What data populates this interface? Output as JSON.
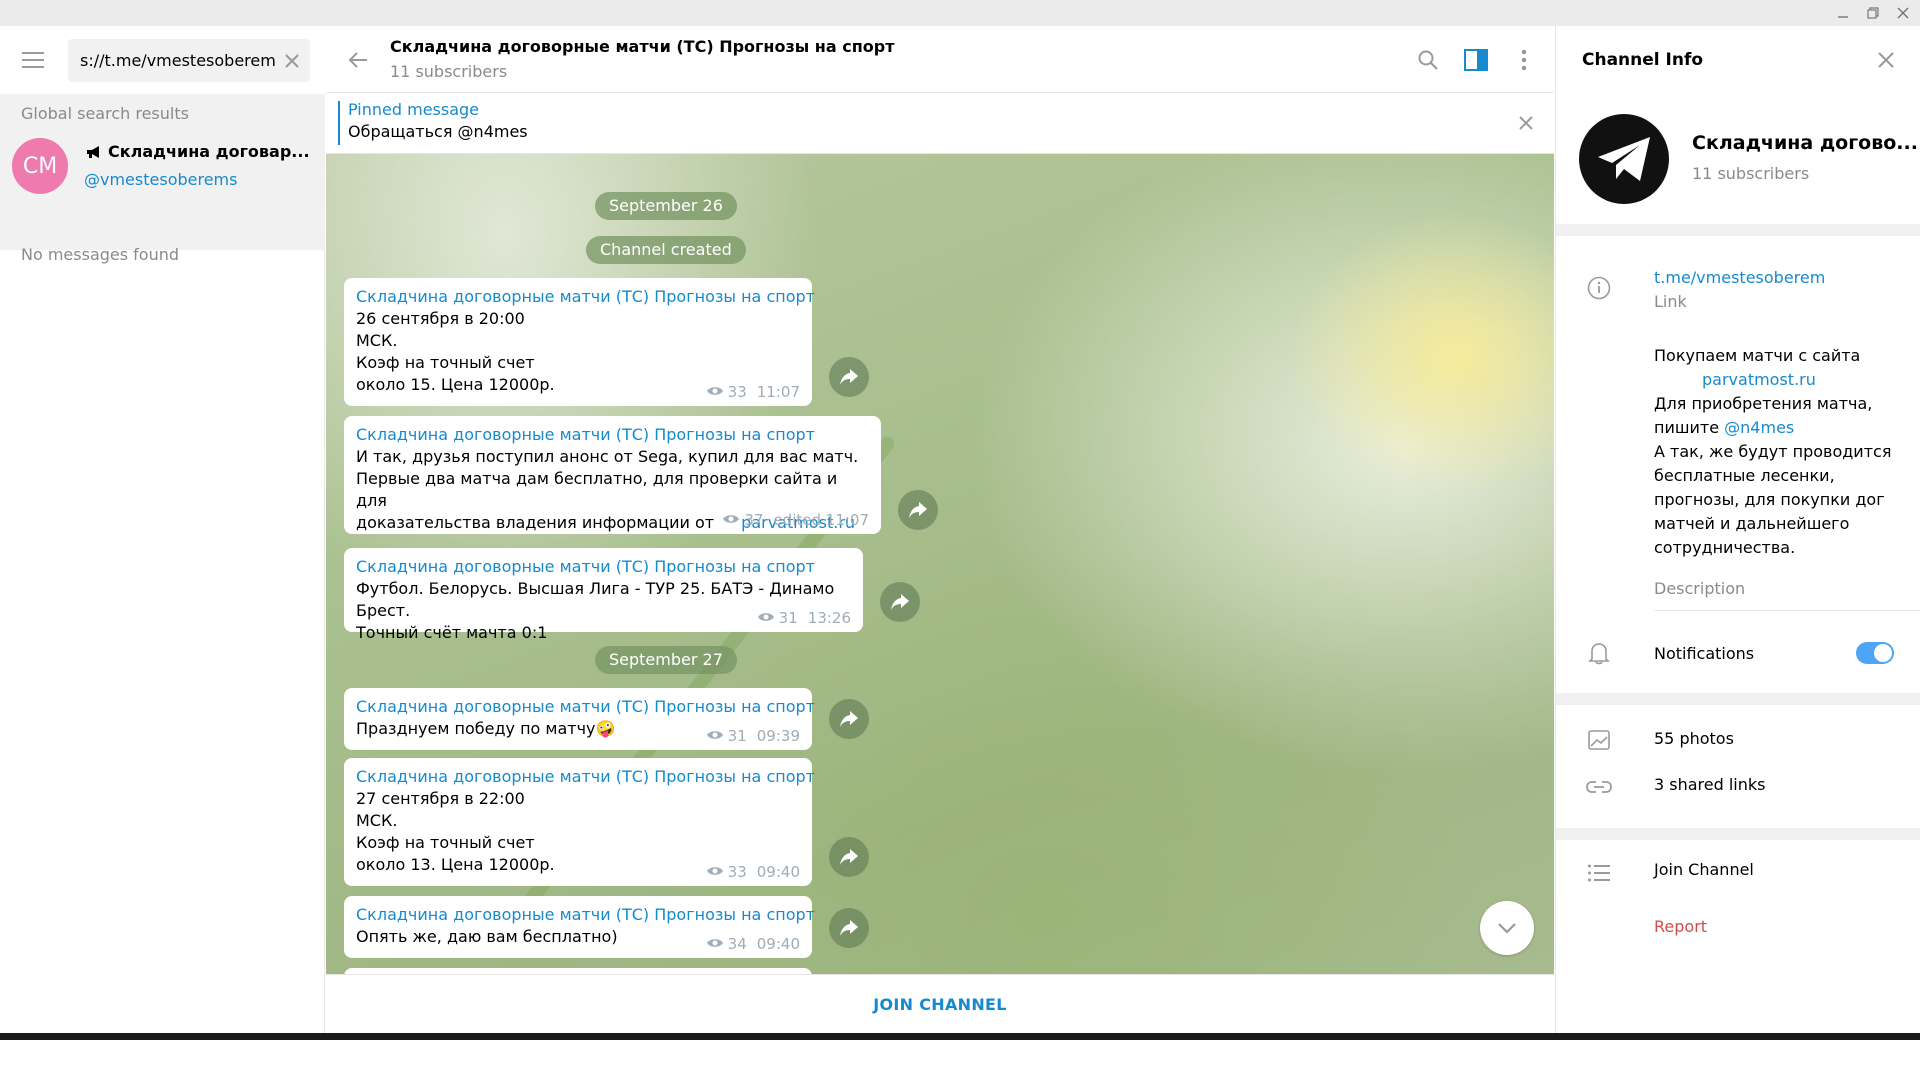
{
  "window": {
    "controls": [
      "minimize",
      "maximize",
      "close"
    ]
  },
  "left": {
    "search_value": "s://t.me/vmestesoberems",
    "results_header": "Global search results",
    "result": {
      "avatar_initials": "CM",
      "avatar_color": "#ee7aae",
      "title": "Складчина договар...",
      "handle": "@vmestesoberems"
    },
    "no_messages": "No messages found"
  },
  "chat": {
    "title": "Складчина договорные матчи (ТС) Прогнозы на спорт",
    "subscribers": "11 subscribers",
    "pinned_label": "Pinned message",
    "pinned_text": "Обращаться @n4mes",
    "date1": "September 26",
    "service": "Channel created",
    "date2": "September 27",
    "author": "Складчина договорные матчи (ТС) Прогнозы на спорт",
    "messages": [
      {
        "lines": "26 сентября в 20:00\nМСК.\nКоэф на точный счет\nоколо 15. Цена 12000р.",
        "views": "33",
        "time": "11:07"
      },
      {
        "lines": "И так, друзья поступил анонс от Sega, купил для вас матч.\nПервые два матча дам бесплатно, для проверки сайта и для\nдоказательства владения информации от ",
        "link": "parvatmost.ru",
        "views": "37",
        "time": "edited 11:07"
      },
      {
        "lines": "Футбол. Белорусь. Высшая Лига - ТУР 25. БАТЭ - Динамо Брест.\nТочный счёт мачта 0:1",
        "views": "31",
        "time": "13:26"
      },
      {
        "lines": "Празднуем победу по матчу🤪",
        "views": "31",
        "time": "09:39"
      },
      {
        "lines": "27 сентября в 22:00\nМСК.\nКоэф на точный счет\nоколо 13. Цена 12000р.",
        "views": "33",
        "time": "09:40"
      },
      {
        "lines": "Опять же, даю вам бесплатно)",
        "views": "34",
        "time": "09:40"
      }
    ],
    "join_label": "JOIN CHANNEL"
  },
  "info": {
    "title": "Channel Info",
    "name": "Складчина догово...",
    "subscribers": "11 subscribers",
    "link": "t.me/vmestesoberem",
    "link_label": "Link",
    "desc_1": "Покупаем матчи с сайта",
    "desc_link1": "parvatmost.ru",
    "desc_2": "Для приобретения матча, пишите ",
    "desc_handle": "@n4mes",
    "desc_3": "А так, же будут проводится бесплатные лесенки, прогнозы, для покупки дог матчей и дальнейшего сотрудничества.",
    "desc_label": "Description",
    "notifications": "Notifications",
    "notifications_on": true,
    "photos": "55 photos",
    "links": "3 shared links",
    "join": "Join Channel",
    "report": "Report"
  },
  "colors": {
    "accent": "#168acd",
    "toggle": "#4ea4f6",
    "report": "#d14e4e"
  }
}
